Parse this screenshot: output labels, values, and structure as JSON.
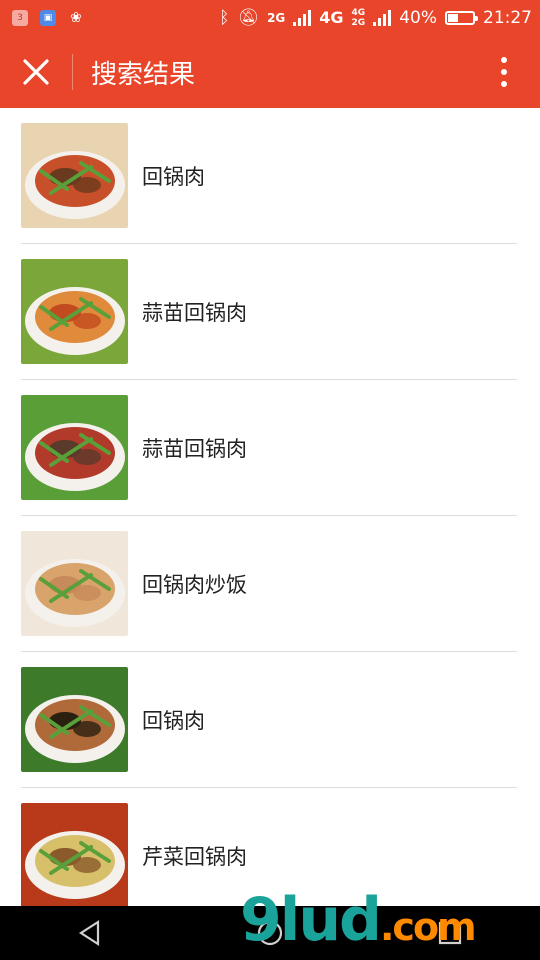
{
  "status_bar": {
    "notif_count": "3",
    "network1": "2G",
    "network2": "4G",
    "network3": "4G",
    "network4": "2G",
    "battery": "40%",
    "battery_level": 0.4,
    "time": "21:27"
  },
  "app_bar": {
    "title": "搜索结果"
  },
  "results": [
    {
      "title": "回锅肉",
      "colors": [
        "#6a3a1e",
        "#c7502b",
        "#e8d4b0"
      ]
    },
    {
      "title": "蒜苗回锅肉",
      "colors": [
        "#c24a1f",
        "#e08a3b",
        "#7aa63a"
      ]
    },
    {
      "title": "蒜苗回锅肉",
      "colors": [
        "#5a3a2a",
        "#b23a2a",
        "#5a9e38"
      ]
    },
    {
      "title": "回锅肉炒饭",
      "colors": [
        "#c78a5a",
        "#d9a46b",
        "#f0e6da"
      ]
    },
    {
      "title": "回锅肉",
      "colors": [
        "#2a2010",
        "#b06a3a",
        "#3d7a2a"
      ]
    },
    {
      "title": "芹菜回锅肉",
      "colors": [
        "#8a5a2a",
        "#d8c06a",
        "#b83a1a"
      ]
    }
  ],
  "watermark": {
    "text": "9lud",
    "suffix": ".com"
  }
}
